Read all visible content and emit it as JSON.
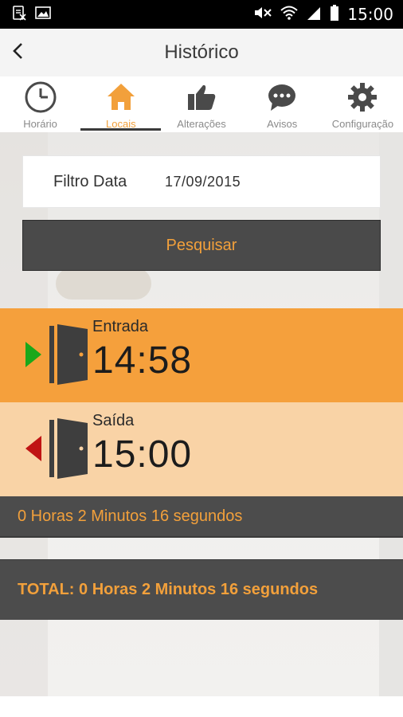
{
  "status_bar": {
    "time": "15:00",
    "icons": [
      "no-sim-icon",
      "image-icon",
      "mute-icon",
      "wifi-icon",
      "signal-icon",
      "battery-icon"
    ]
  },
  "app_bar": {
    "title": "Histórico",
    "back_icon": "chevron-left-icon"
  },
  "tabs": [
    {
      "label": "Horário",
      "icon": "clock-icon",
      "active": false
    },
    {
      "label": "Locais",
      "icon": "home-icon",
      "active": true
    },
    {
      "label": "Alterações",
      "icon": "thumbs-up-icon",
      "active": false
    },
    {
      "label": "Avisos",
      "icon": "chat-icon",
      "active": false
    },
    {
      "label": "Configuração",
      "icon": "gear-icon",
      "active": false
    }
  ],
  "filter": {
    "label": "Filtro Data",
    "value": "17/09/2015"
  },
  "search_button": {
    "label": "Pesquisar"
  },
  "records": [
    {
      "type": "Entrada",
      "time": "14:58",
      "arrow_color": "#1aa81a"
    },
    {
      "type": "Saída",
      "time": "15:00",
      "arrow_color": "#c01414"
    }
  ],
  "duration": "0 Horas 2 Minutos 16 segundos",
  "total": "TOTAL: 0 Horas 2 Minutos 16 segundos",
  "colors": {
    "accent": "#f2a03b",
    "entrada_bg": "#f5a03c",
    "saida_bg": "#f9d3a6",
    "dark_bar": "#4c4c4c"
  }
}
